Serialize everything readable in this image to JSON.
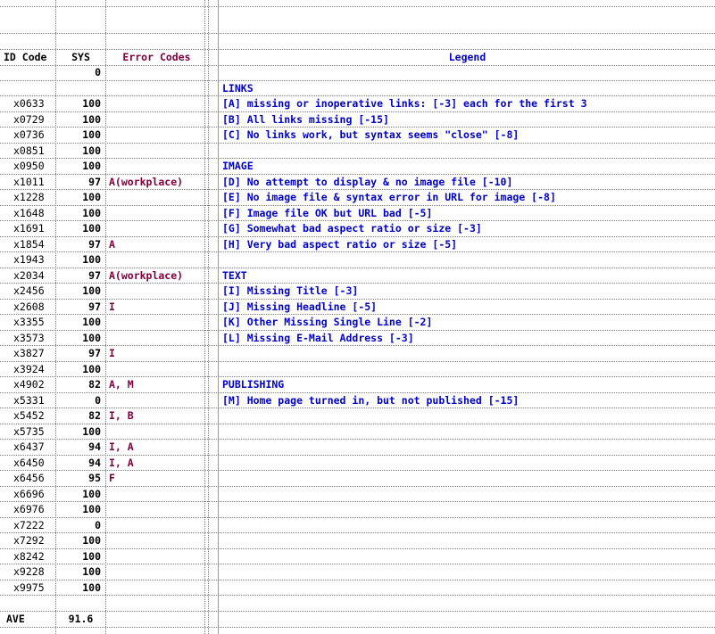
{
  "headers": {
    "id": "ID Code",
    "sys": "SYS",
    "errors": "Error Codes",
    "legend": "Legend"
  },
  "extra_sys": "0",
  "rows": [
    {
      "id": "x0633",
      "sys": "100",
      "err": "",
      "legend": "[A] missing or inoperative links: [-3] each for the first 3"
    },
    {
      "id": "x0729",
      "sys": "100",
      "err": "",
      "legend": "[B] All links missing [-15]"
    },
    {
      "id": "x0736",
      "sys": "100",
      "err": "",
      "legend": "[C] No links work, but syntax seems \"close\" [-8]"
    },
    {
      "id": "x0851",
      "sys": "100",
      "err": "",
      "legend": ""
    },
    {
      "id": "x0950",
      "sys": "100",
      "err": "",
      "legend": "IMAGE"
    },
    {
      "id": "x1011",
      "sys": "97",
      "err": "A(workplace)",
      "legend": "[D] No attempt to display & no image file [-10]"
    },
    {
      "id": "x1228",
      "sys": "100",
      "err": "",
      "legend": "[E] No image file & syntax error in URL for image [-8]"
    },
    {
      "id": "x1648",
      "sys": "100",
      "err": "",
      "legend": "[F] Image file OK but URL bad [-5]"
    },
    {
      "id": "x1691",
      "sys": "100",
      "err": "",
      "legend": "[G] Somewhat bad aspect ratio or size [-3]"
    },
    {
      "id": "x1854",
      "sys": "97",
      "err": "A",
      "legend": "[H] Very bad aspect ratio or size [-5]"
    },
    {
      "id": "x1943",
      "sys": "100",
      "err": "",
      "legend": ""
    },
    {
      "id": "x2034",
      "sys": "97",
      "err": "A(workplace)",
      "legend": "TEXT"
    },
    {
      "id": "x2456",
      "sys": "100",
      "err": "",
      "legend": "[I] Missing Title [-3]"
    },
    {
      "id": "x2608",
      "sys": "97",
      "err": "I",
      "legend": "[J] Missing Headline [-5]"
    },
    {
      "id": "x3355",
      "sys": "100",
      "err": "",
      "legend": "[K] Other Missing Single Line [-2]"
    },
    {
      "id": "x3573",
      "sys": "100",
      "err": "",
      "legend": "[L] Missing E-Mail Address [-3]"
    },
    {
      "id": "x3827",
      "sys": "97",
      "err": "I",
      "legend": ""
    },
    {
      "id": "x3924",
      "sys": "100",
      "err": "",
      "legend": ""
    },
    {
      "id": "x4902",
      "sys": "82",
      "err": "A, M",
      "legend": "PUBLISHING"
    },
    {
      "id": "x5331",
      "sys": "0",
      "err": "",
      "legend": "[M] Home page turned in, but not published [-15]"
    },
    {
      "id": "x5452",
      "sys": "82",
      "err": "I, B",
      "legend": ""
    },
    {
      "id": "x5735",
      "sys": "100",
      "err": "",
      "legend": ""
    },
    {
      "id": "x6437",
      "sys": "94",
      "err": "I, A",
      "legend": ""
    },
    {
      "id": "x6450",
      "sys": "94",
      "err": "I, A",
      "legend": ""
    },
    {
      "id": "x6456",
      "sys": "95",
      "err": "F",
      "legend": ""
    },
    {
      "id": "x6696",
      "sys": "100",
      "err": "",
      "legend": ""
    },
    {
      "id": "x6976",
      "sys": "100",
      "err": "",
      "legend": ""
    },
    {
      "id": "x7222",
      "sys": "0",
      "err": "",
      "legend": ""
    },
    {
      "id": "x7292",
      "sys": "100",
      "err": "",
      "legend": ""
    },
    {
      "id": "x8242",
      "sys": "100",
      "err": "",
      "legend": ""
    },
    {
      "id": "x9228",
      "sys": "100",
      "err": "",
      "legend": ""
    },
    {
      "id": "x9975",
      "sys": "100",
      "err": "",
      "legend": ""
    }
  ],
  "links_heading": "LINKS",
  "ave": {
    "label": "AVE",
    "value": "91.6"
  }
}
